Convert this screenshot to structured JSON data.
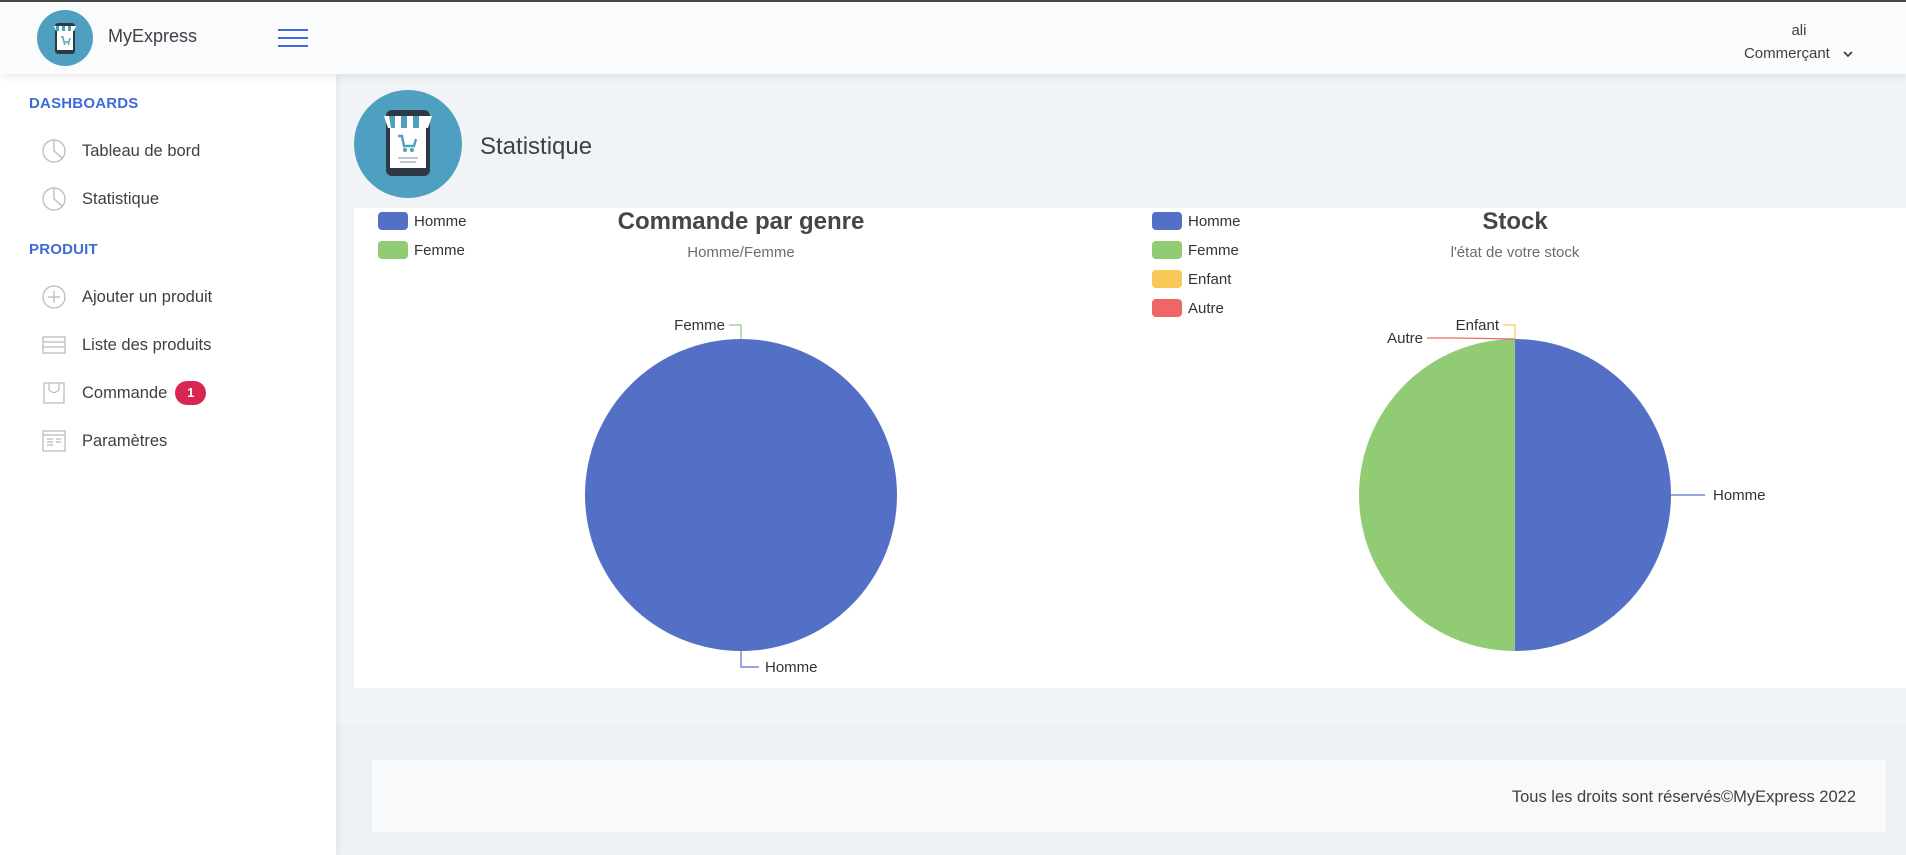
{
  "header": {
    "app_name": "MyExpress",
    "user_name": "ali",
    "user_role": "Commerçant"
  },
  "sidebar": {
    "sections": [
      {
        "heading": "DASHBOARDS"
      },
      {
        "heading": "PRODUIT"
      }
    ],
    "items": [
      {
        "label": "Tableau de bord",
        "icon": "pie-chart-icon"
      },
      {
        "label": "Statistique",
        "icon": "pie-chart-icon"
      },
      {
        "label": "Ajouter un produit",
        "icon": "plus-circle-icon"
      },
      {
        "label": "Liste des produits",
        "icon": "list-icon"
      },
      {
        "label": "Commande",
        "icon": "bag-icon",
        "badge": "1"
      },
      {
        "label": "Paramètres",
        "icon": "settings-icon"
      }
    ]
  },
  "page": {
    "title": "Statistique"
  },
  "colors": {
    "accent": "#3f6ad8",
    "homme": "#5470c6",
    "femme": "#91cc75",
    "enfant": "#fac858",
    "autre": "#ee6666",
    "badge": "#d92550"
  },
  "chart_data": [
    {
      "type": "pie",
      "title": "Commande par genre",
      "subtitle": "Homme/Femme",
      "legend": [
        "Homme",
        "Femme"
      ],
      "legend_position": "top-left",
      "slices": [
        {
          "label": "Homme",
          "value": 1,
          "color": "#5470c6"
        },
        {
          "label": "Femme",
          "value": 0,
          "color": "#91cc75"
        }
      ]
    },
    {
      "type": "pie",
      "title": "Stock",
      "subtitle": "l'état de votre stock",
      "legend": [
        "Homme",
        "Femme",
        "Enfant",
        "Autre"
      ],
      "legend_position": "top-left",
      "slices": [
        {
          "label": "Homme",
          "value": 1,
          "color": "#5470c6"
        },
        {
          "label": "Femme",
          "value": 1,
          "color": "#91cc75"
        },
        {
          "label": "Enfant",
          "value": 0,
          "color": "#fac858"
        },
        {
          "label": "Autre",
          "value": 0,
          "color": "#ee6666"
        }
      ]
    }
  ],
  "footer": {
    "text": "Tous les droits sont réservés©MyExpress 2022"
  }
}
